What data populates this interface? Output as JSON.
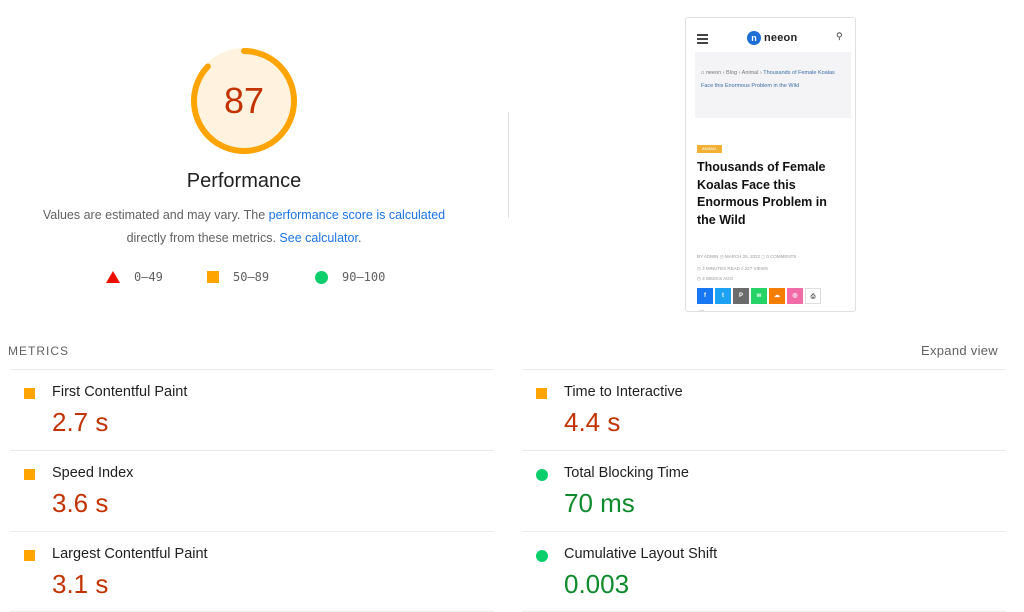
{
  "performance": {
    "score": "87",
    "score_fraction": 0.87,
    "title": "Performance",
    "desc_prefix": "Values are estimated and may vary. The ",
    "desc_link1": "performance score is calculated",
    "desc_middle": "directly from these metrics. ",
    "desc_link2": "See calculator",
    "desc_suffix": ".",
    "colors": {
      "average": "#ffa400",
      "average_text": "#c33300",
      "fail": "#eb0f00",
      "pass": "#0cce6b",
      "pass_text": "#0f8a2c"
    }
  },
  "legend": [
    {
      "range": "0–49",
      "icon": "red-triangle-icon"
    },
    {
      "range": "50–89",
      "icon": "orange-square-icon"
    },
    {
      "range": "90–100",
      "icon": "green-circle-icon"
    }
  ],
  "screenshot": {
    "logo_text": "neeon",
    "logo_badge": "n",
    "breadcrumb": {
      "home": "neeon",
      "blog": "Blog",
      "category": "Animal",
      "current": "Thousands of Female Koalas Face this Enormous Problem in the Wild"
    },
    "badge": "ANIMAL",
    "title": "Thousands of Female Koalas Face this Enormous Problem in the Wild",
    "meta1": "BY ADMIN    ◷ MARCH 25, 2022    ◻ 0 COMMENTS",
    "meta2": "◷ 3 MINUTES READ    ıl 227 VIEWS",
    "meta3": "◷ 3 WEEKS AGO",
    "share": [
      {
        "glyph": "f",
        "color": "#1877f2"
      },
      {
        "glyph": "t",
        "color": "#1da1f2"
      },
      {
        "glyph": "P",
        "color": "#6b6b6b"
      },
      {
        "glyph": "w",
        "color": "#25d366"
      },
      {
        "glyph": "☁",
        "color": "#f57d00"
      },
      {
        "glyph": "◎",
        "color": "#f06ba8"
      },
      {
        "glyph": "⎙",
        "color": ""
      }
    ],
    "footer_glyph": "▭"
  },
  "metrics": {
    "label": "METRICS",
    "expand_label": "Expand view",
    "items": [
      {
        "name": "First Contentful Paint",
        "value": "2.7 s",
        "rating": "average"
      },
      {
        "name": "Time to Interactive",
        "value": "4.4 s",
        "rating": "average"
      },
      {
        "name": "Speed Index",
        "value": "3.6 s",
        "rating": "average"
      },
      {
        "name": "Total Blocking Time",
        "value": "70 ms",
        "rating": "pass"
      },
      {
        "name": "Largest Contentful Paint",
        "value": "3.1 s",
        "rating": "average"
      },
      {
        "name": "Cumulative Layout Shift",
        "value": "0.003",
        "rating": "pass"
      }
    ]
  }
}
